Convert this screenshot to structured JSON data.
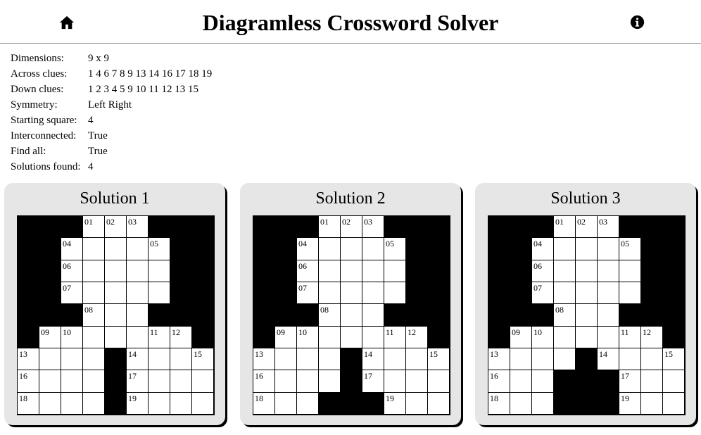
{
  "header": {
    "title": "Diagramless Crossword Solver",
    "home_icon": "home-icon",
    "info_icon": "info-icon"
  },
  "info": [
    {
      "label": "Dimensions:",
      "value": "9 x 9"
    },
    {
      "label": "Across clues:",
      "value": "1 4 6 7 8 9 13 14 16 17 18 19"
    },
    {
      "label": "Down clues:",
      "value": "1 2 3 4 5 9 10 11 12 13 15"
    },
    {
      "label": "Symmetry:",
      "value": "Left Right"
    },
    {
      "label": "Starting square:",
      "value": "4"
    },
    {
      "label": "Interconnected:",
      "value": "True"
    },
    {
      "label": "Find all:",
      "value": "True"
    },
    {
      "label": "Solutions found:",
      "value": "4"
    }
  ],
  "solutions": [
    {
      "title": "Solution 1",
      "rows": [
        "###...###",
        "##.....##",
        "##.....##",
        "##.....##",
        "###...###",
        "#.......#",
        "....#....",
        "....#....",
        "....#...."
      ],
      "numbers": [
        [
          0,
          3,
          "01"
        ],
        [
          0,
          4,
          "02"
        ],
        [
          0,
          5,
          "03"
        ],
        [
          1,
          2,
          "04"
        ],
        [
          1,
          6,
          "05"
        ],
        [
          2,
          2,
          "06"
        ],
        [
          3,
          2,
          "07"
        ],
        [
          4,
          3,
          "08"
        ],
        [
          5,
          1,
          "09"
        ],
        [
          5,
          2,
          "10"
        ],
        [
          5,
          6,
          "11"
        ],
        [
          5,
          7,
          "12"
        ],
        [
          6,
          0,
          "13"
        ],
        [
          6,
          5,
          "14"
        ],
        [
          6,
          8,
          "15"
        ],
        [
          7,
          0,
          "16"
        ],
        [
          7,
          5,
          "17"
        ],
        [
          8,
          0,
          "18"
        ],
        [
          8,
          5,
          "19"
        ]
      ]
    },
    {
      "title": "Solution 2",
      "rows": [
        "###...###",
        "##.....##",
        "##.....##",
        "##.....##",
        "###...###",
        "#.......#",
        "....#....",
        "....#....",
        "...###..."
      ],
      "numbers": [
        [
          0,
          3,
          "01"
        ],
        [
          0,
          4,
          "02"
        ],
        [
          0,
          5,
          "03"
        ],
        [
          1,
          2,
          "04"
        ],
        [
          1,
          6,
          "05"
        ],
        [
          2,
          2,
          "06"
        ],
        [
          3,
          2,
          "07"
        ],
        [
          4,
          3,
          "08"
        ],
        [
          5,
          1,
          "09"
        ],
        [
          5,
          2,
          "10"
        ],
        [
          5,
          6,
          "11"
        ],
        [
          5,
          7,
          "12"
        ],
        [
          6,
          0,
          "13"
        ],
        [
          6,
          5,
          "14"
        ],
        [
          6,
          8,
          "15"
        ],
        [
          7,
          0,
          "16"
        ],
        [
          7,
          5,
          "17"
        ],
        [
          8,
          0,
          "18"
        ],
        [
          8,
          6,
          "19"
        ]
      ]
    },
    {
      "title": "Solution 3",
      "rows": [
        "###...###",
        "##.....##",
        "##.....##",
        "##.....##",
        "###...###",
        "#.......#",
        "....#....",
        "...###...",
        "...###..."
      ],
      "numbers": [
        [
          0,
          3,
          "01"
        ],
        [
          0,
          4,
          "02"
        ],
        [
          0,
          5,
          "03"
        ],
        [
          1,
          2,
          "04"
        ],
        [
          1,
          6,
          "05"
        ],
        [
          2,
          2,
          "06"
        ],
        [
          3,
          2,
          "07"
        ],
        [
          4,
          3,
          "08"
        ],
        [
          5,
          1,
          "09"
        ],
        [
          5,
          2,
          "10"
        ],
        [
          5,
          6,
          "11"
        ],
        [
          5,
          7,
          "12"
        ],
        [
          6,
          0,
          "13"
        ],
        [
          6,
          5,
          "14"
        ],
        [
          6,
          8,
          "15"
        ],
        [
          7,
          0,
          "16"
        ],
        [
          7,
          6,
          "17"
        ],
        [
          8,
          0,
          "18"
        ],
        [
          8,
          6,
          "19"
        ]
      ]
    }
  ]
}
